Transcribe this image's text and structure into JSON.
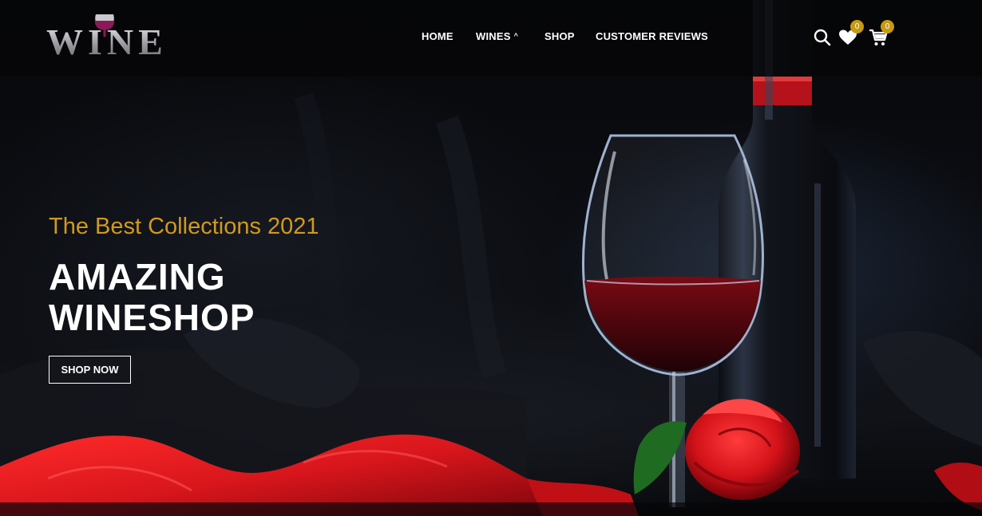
{
  "brand": {
    "logo_text": "WINE"
  },
  "nav": {
    "items": [
      {
        "label": "HOME"
      },
      {
        "label": "WINES"
      },
      {
        "label": "SHOP"
      },
      {
        "label": "CUSTOMER REVIEWS"
      }
    ]
  },
  "header_icons": {
    "search": "search-icon",
    "wishlist": {
      "icon": "heart-icon",
      "count": "0"
    },
    "cart": {
      "icon": "cart-icon",
      "count": "0"
    }
  },
  "hero": {
    "subtitle": "The Best Collections 2021",
    "title_line1": "AMAZING",
    "title_line2": "WINESHOP",
    "cta_label": "SHOP NOW"
  },
  "colors": {
    "accent": "#d19a1c",
    "badge": "#c69a12",
    "wine_red": "#b5121b",
    "background": "#07080b"
  }
}
